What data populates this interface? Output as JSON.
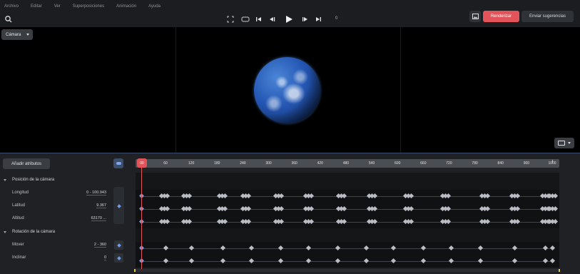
{
  "menu": [
    "Archivo",
    "Editar",
    "Ver",
    "Superposiciones",
    "Animación",
    "Ayuda"
  ],
  "toolbar": {
    "frame": "0",
    "render_label": "Renderizar",
    "feedback_label": "Enviar sugerencias",
    "icons": [
      "search-icon",
      "fullscreen-icon",
      "loop-icon",
      "skip-start-icon",
      "prev-keyframe-icon",
      "play-icon",
      "next-keyframe-icon",
      "skip-end-icon",
      "image-icon"
    ]
  },
  "viewport": {
    "camera_label": "Cámara"
  },
  "timeline": {
    "add_attributes_label": "Añadir atributos",
    "playhead_label": "00",
    "ticks": [
      "60",
      "120",
      "180",
      "240",
      "300",
      "360",
      "420",
      "480",
      "540",
      "600",
      "660",
      "720",
      "780",
      "840",
      "900",
      "1000"
    ],
    "groups": [
      {
        "label": "Posición de la cámara",
        "rows": [
          {
            "label": "Longitud",
            "value": "0 - 100.943"
          },
          {
            "label": "Latitud",
            "value": "9.367"
          },
          {
            "label": "Altitud",
            "value": "63170 ..."
          }
        ]
      },
      {
        "label": "Rotación de la cámara",
        "rows": [
          {
            "label": "Mover",
            "value": "2 - 360"
          },
          {
            "label": "Inclinar",
            "value": "0"
          }
        ]
      }
    ]
  },
  "colors": {
    "accent_red": "#e2545a",
    "keyframe_blue": "#6e9be6",
    "panel_bg": "#1f2124"
  }
}
